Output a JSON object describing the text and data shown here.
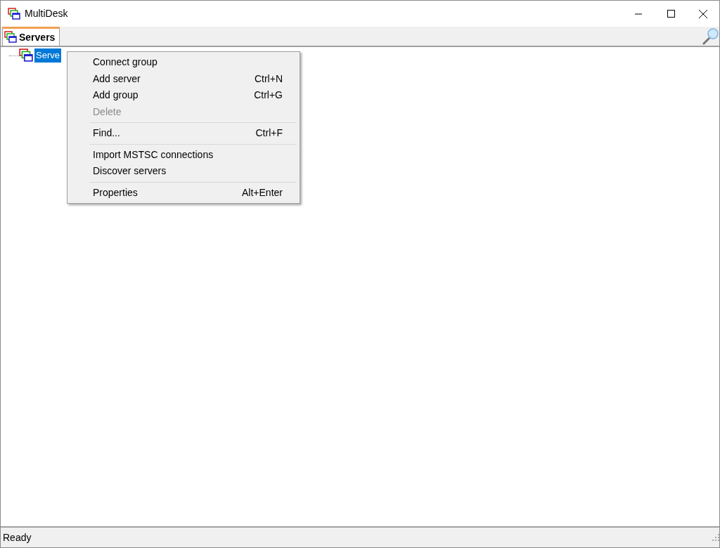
{
  "window": {
    "title": "MultiDesk"
  },
  "tabs": [
    {
      "label": "Servers",
      "selected": true
    }
  ],
  "tree": [
    {
      "label": "Serve",
      "selected": true
    }
  ],
  "context_menu": [
    {
      "kind": "item",
      "label": "Connect group",
      "disabled": false
    },
    {
      "kind": "item",
      "label": "Add server",
      "shortcut": "Ctrl+N",
      "disabled": false
    },
    {
      "kind": "item",
      "label": "Add group",
      "shortcut": "Ctrl+G",
      "disabled": false
    },
    {
      "kind": "item",
      "label": "Delete",
      "disabled": true
    },
    {
      "kind": "separator"
    },
    {
      "kind": "item",
      "label": "Find...",
      "shortcut": "Ctrl+F",
      "disabled": false
    },
    {
      "kind": "separator"
    },
    {
      "kind": "item",
      "label": "Import MSTSC connections",
      "disabled": false
    },
    {
      "kind": "item",
      "label": "Discover servers",
      "disabled": false
    },
    {
      "kind": "separator"
    },
    {
      "kind": "item",
      "label": "Properties",
      "shortcut": "Alt+Enter",
      "disabled": false
    }
  ],
  "status_bar": {
    "text": "Ready"
  }
}
